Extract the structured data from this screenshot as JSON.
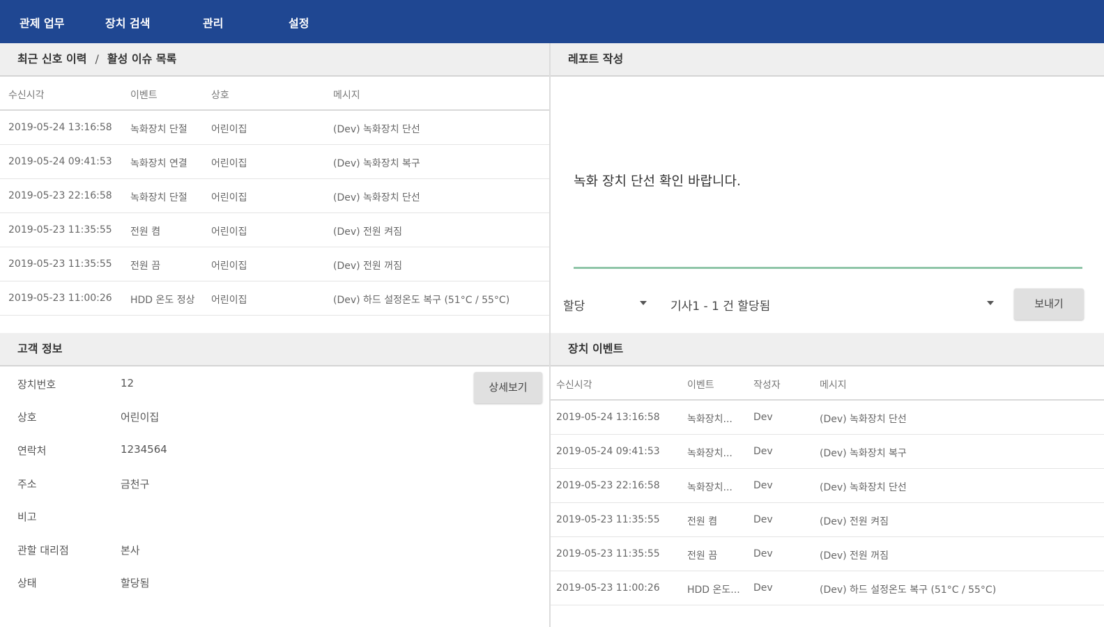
{
  "nav": {
    "items": [
      {
        "label": "관제 업무"
      },
      {
        "label": "장치 검색"
      },
      {
        "label": "관리"
      },
      {
        "label": "설정"
      }
    ]
  },
  "signals": {
    "breadcrumb": [
      "최근 신호 이력",
      "활성 이슈 목록"
    ],
    "breadcrumb_sep": "/",
    "columns": [
      "수신시각",
      "이벤트",
      "상호",
      "메시지"
    ],
    "rows": [
      {
        "time": "2019-05-24 13:16:58",
        "event": "녹화장치 단절",
        "store": "어린이집",
        "message": "(Dev) 녹화장치 단선"
      },
      {
        "time": "2019-05-24 09:41:53",
        "event": "녹화장치 연결",
        "store": "어린이집",
        "message": "(Dev) 녹화장치 복구"
      },
      {
        "time": "2019-05-23 22:16:58",
        "event": "녹화장치 단절",
        "store": "어린이집",
        "message": "(Dev) 녹화장치 단선"
      },
      {
        "time": "2019-05-23 11:35:55",
        "event": "전원 켬",
        "store": "어린이집",
        "message": "(Dev) 전원 켜짐"
      },
      {
        "time": "2019-05-23 11:35:55",
        "event": "전원 끔",
        "store": "어린이집",
        "message": "(Dev) 전원 꺼짐"
      },
      {
        "time": "2019-05-23 11:00:26",
        "event": "HDD 온도 정상",
        "store": "어린이집",
        "message": "(Dev) 하드 설정온도 복구 (51°C / 55°C)"
      }
    ]
  },
  "report": {
    "title": "레포트 작성",
    "text": "녹화 장치 단선 확인 바랍니다.",
    "type_select": "할당",
    "assignee_select": "기사1 - 1 건 할당됨",
    "send_label": "보내기"
  },
  "customer": {
    "title": "고객 정보",
    "detail_label": "상세보기",
    "fields": [
      {
        "label": "장치번호",
        "value": "12"
      },
      {
        "label": "상호",
        "value": "어린이집"
      },
      {
        "label": "연락처",
        "value": "1234564"
      },
      {
        "label": "주소",
        "value": "금천구"
      },
      {
        "label": "비고",
        "value": ""
      },
      {
        "label": "관할 대리점",
        "value": "본사"
      },
      {
        "label": "상태",
        "value": "할당됨"
      }
    ]
  },
  "device_events": {
    "title": "장치 이벤트",
    "columns": [
      "수신시각",
      "이벤트",
      "작성자",
      "메시지"
    ],
    "rows": [
      {
        "time": "2019-05-24 13:16:58",
        "event": "녹화장치...",
        "author": "Dev",
        "message": "(Dev) 녹화장치 단선"
      },
      {
        "time": "2019-05-24 09:41:53",
        "event": "녹화장치...",
        "author": "Dev",
        "message": "(Dev) 녹화장치 복구"
      },
      {
        "time": "2019-05-23 22:16:58",
        "event": "녹화장치...",
        "author": "Dev",
        "message": "(Dev) 녹화장치 단선"
      },
      {
        "time": "2019-05-23 11:35:55",
        "event": "전원 켬",
        "author": "Dev",
        "message": "(Dev) 전원 켜짐"
      },
      {
        "time": "2019-05-23 11:35:55",
        "event": "전원 끔",
        "author": "Dev",
        "message": "(Dev) 전원 꺼짐"
      },
      {
        "time": "2019-05-23 11:00:26",
        "event": "HDD 온도...",
        "author": "Dev",
        "message": "(Dev) 하드 설정온도 복구 (51°C / 55°C)"
      }
    ]
  },
  "colors": {
    "topbar": "#1f4792",
    "header_bg": "#efefef",
    "input_underline": "#8fc5a8",
    "button_bg": "#e0e0e0"
  }
}
